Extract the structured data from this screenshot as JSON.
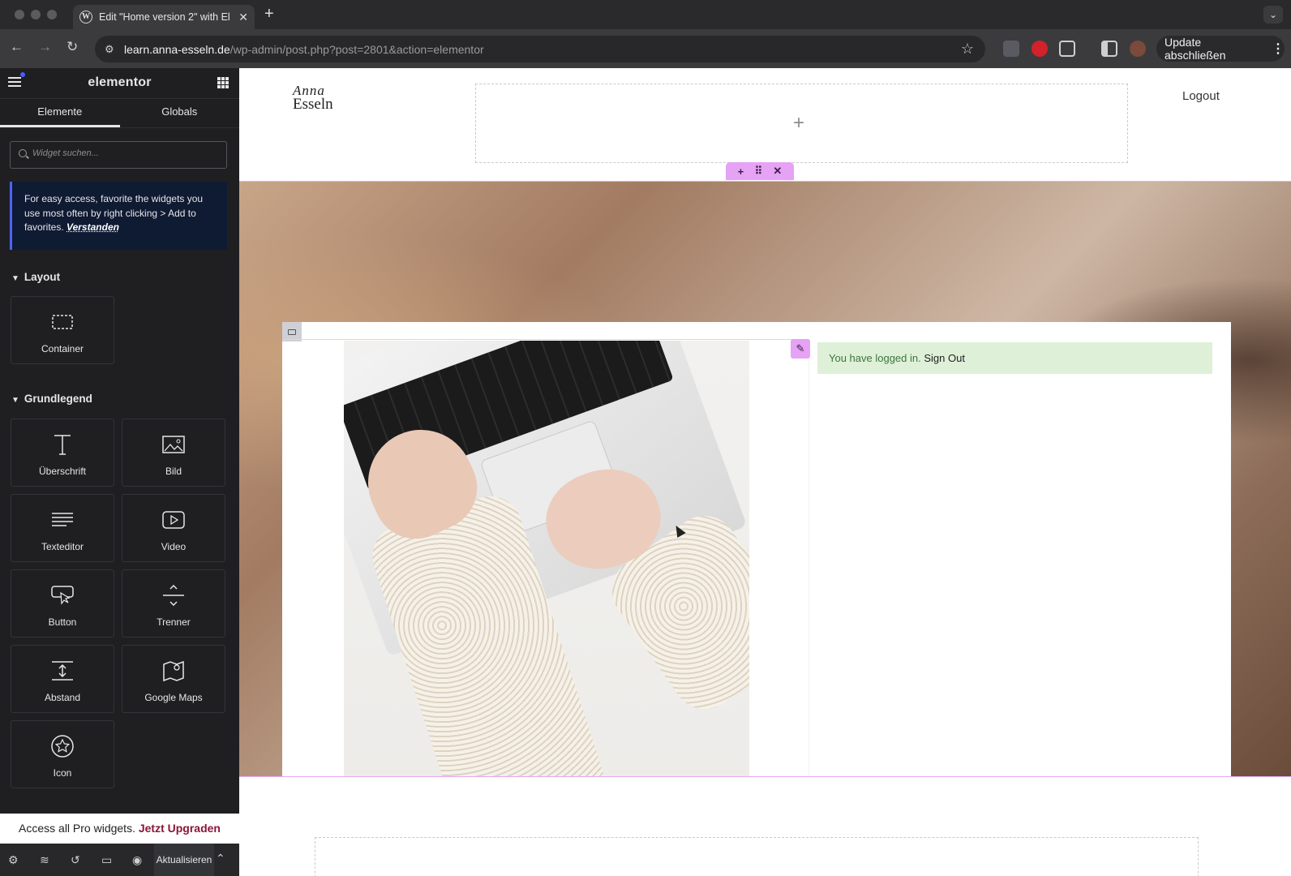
{
  "browser": {
    "tab_title": "Edit \"Home version 2\" with El",
    "url_host": "learn.anna-esseln.de",
    "url_path": "/wp-admin/post.php?post=2801&action=elementor",
    "update_button": "Update abschließen"
  },
  "sidebar": {
    "brand": "elementor",
    "tabs": [
      {
        "label": "Elemente"
      },
      {
        "label": "Globals"
      }
    ],
    "search_placeholder": "Widget suchen...",
    "tip": {
      "text": "For easy access, favorite the widgets you use most often by right clicking > Add to favorites.",
      "link": "Verstanden"
    },
    "sections": [
      {
        "title": "Layout",
        "widgets": [
          {
            "label": "Container",
            "icon": "container-icon"
          }
        ]
      },
      {
        "title": "Grundlegend",
        "widgets": [
          {
            "label": "Überschrift",
            "icon": "heading-icon"
          },
          {
            "label": "Bild",
            "icon": "image-icon"
          },
          {
            "label": "Texteditor",
            "icon": "text-editor-icon"
          },
          {
            "label": "Video",
            "icon": "video-icon"
          },
          {
            "label": "Button",
            "icon": "button-icon"
          },
          {
            "label": "Trenner",
            "icon": "divider-icon"
          },
          {
            "label": "Abstand",
            "icon": "spacer-icon"
          },
          {
            "label": "Google Maps",
            "icon": "map-icon"
          },
          {
            "label": "Icon",
            "icon": "star-icon"
          }
        ]
      }
    ],
    "pro_banner": {
      "text": "Access all Pro widgets.",
      "link": "Jetzt Upgraden"
    },
    "footer": {
      "publish": "Aktualisieren"
    }
  },
  "canvas": {
    "logo": {
      "line1": "Anna",
      "line2": "Esseln"
    },
    "nav_logout": "Logout",
    "login_message": "You have logged in.",
    "sign_out": "Sign Out"
  },
  "colors": {
    "accent": "#e6a2f5",
    "tip_border": "#4d63ff",
    "success_bg": "#dff0d8",
    "upgrade_link": "#8a1538"
  }
}
